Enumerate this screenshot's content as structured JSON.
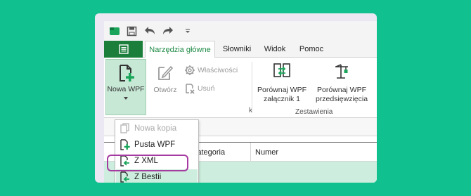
{
  "colors": {
    "accent": "#1f8a46",
    "background": "#10c08e",
    "highlight": "#cdeede",
    "ring": "#a53aa0"
  },
  "qat": {
    "icons": [
      "app-icon",
      "save-icon",
      "undo-icon",
      "redo-icon",
      "customize-icon"
    ]
  },
  "tabs": [
    {
      "label": "Narzędzia główne",
      "active": true
    },
    {
      "label": "Słowniki",
      "active": false
    },
    {
      "label": "Widok",
      "active": false
    },
    {
      "label": "Pomoc",
      "active": false
    }
  ],
  "ribbon": {
    "nowa_wpf": "Nowa WPF",
    "otworz": "Otwórz",
    "wlasciwosci": "Właściwości",
    "usun": "Usuń",
    "porownaj_zal_line1": "Porównaj WPF",
    "porownaj_zal_line2": "załącznik 1",
    "porownaj_przed_line1": "Porównaj WPF",
    "porownaj_przed_line2": "przedsięwzięcia",
    "group_zestawienia": "Zestawienia",
    "group_left_partial": "k"
  },
  "menu": {
    "items": [
      {
        "label": "Nowa kopia",
        "disabled": true
      },
      {
        "label": "Pusta WPF",
        "disabled": false
      },
      {
        "label": "Z XML",
        "disabled": false
      },
      {
        "label": "Z Bestii",
        "disabled": false,
        "highlighted": true
      }
    ]
  },
  "grid": {
    "columns": [
      "Kategoria",
      "Numer"
    ]
  }
}
